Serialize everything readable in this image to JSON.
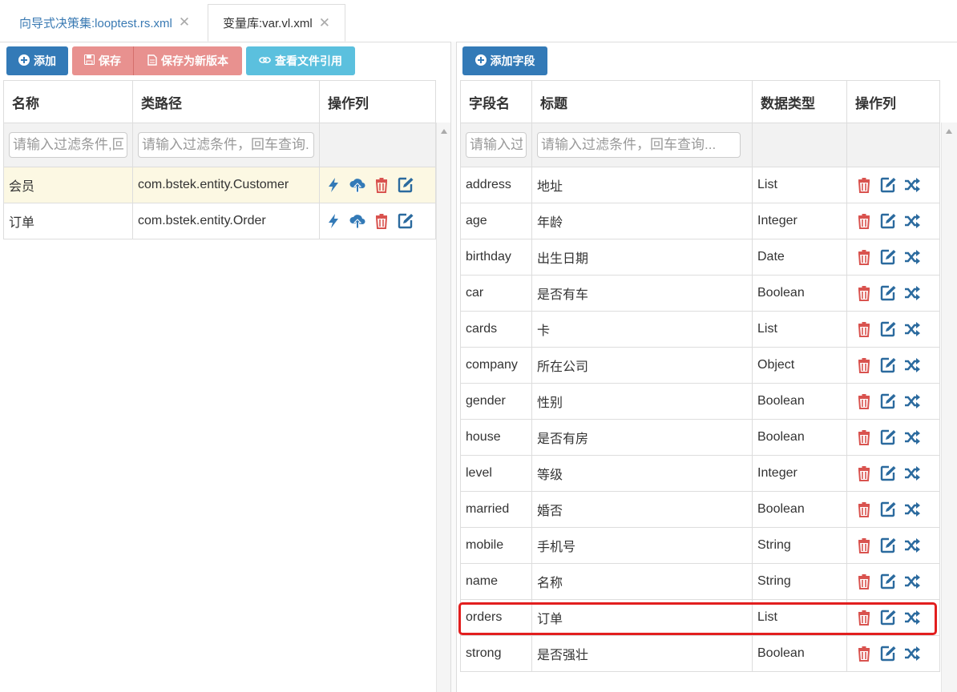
{
  "tabs": [
    {
      "label": "向导式决策集:looptest.rs.xml"
    },
    {
      "label": "变量库:var.vl.xml"
    }
  ],
  "left_toolbar": {
    "add_label": "添加",
    "save_label": "保存",
    "save_new_version_label": "保存为新版本",
    "view_refs_label": "查看文件引用"
  },
  "right_toolbar": {
    "add_field_label": "添加字段"
  },
  "left_table": {
    "headers": [
      "名称",
      "类路径",
      "操作列"
    ],
    "filter_placeholders": [
      "请输入过滤条件,回车查询...",
      "请输入过滤条件，回车查询..."
    ],
    "rows": [
      {
        "name": "会员",
        "class_path": "com.bstek.entity.Customer"
      },
      {
        "name": "订单",
        "class_path": "com.bstek.entity.Order"
      }
    ]
  },
  "right_table": {
    "headers": [
      "字段名",
      "标题",
      "数据类型",
      "操作列"
    ],
    "filter_placeholders": [
      "请输入过滤条件",
      "请输入过滤条件，回车查询..."
    ],
    "rows": [
      {
        "field": "address",
        "title": "地址",
        "type": "List"
      },
      {
        "field": "age",
        "title": "年龄",
        "type": "Integer"
      },
      {
        "field": "birthday",
        "title": "出生日期",
        "type": "Date"
      },
      {
        "field": "car",
        "title": "是否有车",
        "type": "Boolean"
      },
      {
        "field": "cards",
        "title": "卡",
        "type": "List"
      },
      {
        "field": "company",
        "title": "所在公司",
        "type": "Object"
      },
      {
        "field": "gender",
        "title": "性别",
        "type": "Boolean"
      },
      {
        "field": "house",
        "title": "是否有房",
        "type": "Boolean"
      },
      {
        "field": "level",
        "title": "等级",
        "type": "Integer"
      },
      {
        "field": "married",
        "title": "婚否",
        "type": "Boolean"
      },
      {
        "field": "mobile",
        "title": "手机号",
        "type": "String"
      },
      {
        "field": "name",
        "title": "名称",
        "type": "String"
      },
      {
        "field": "orders",
        "title": "订单",
        "type": "List"
      },
      {
        "field": "strong",
        "title": "是否强壮",
        "type": "Boolean"
      }
    ]
  },
  "colors": {
    "primary": "#337ab7",
    "danger": "#d9534f",
    "edit": "#2b6a9e",
    "highlight_row": "#fcf8e3",
    "annotation": "#e21e1e"
  }
}
